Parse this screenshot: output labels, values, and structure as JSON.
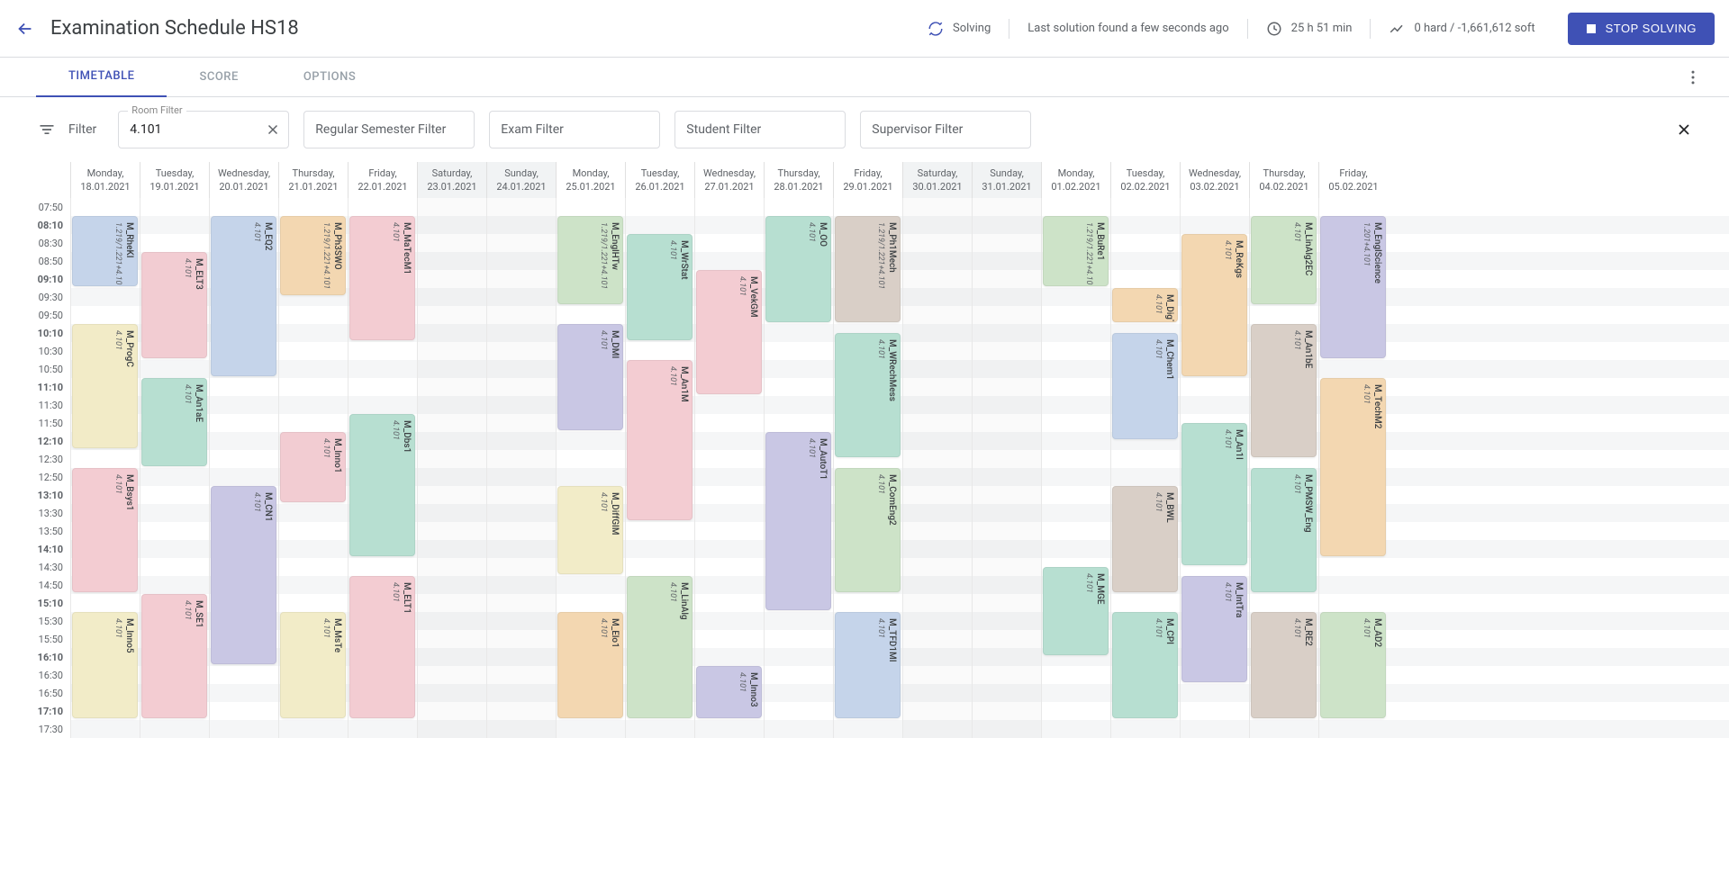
{
  "header": {
    "title": "Examination Schedule HS18",
    "solving_status": "Solving",
    "last_solution": "Last solution found a few seconds ago",
    "duration": "25 h 51 min",
    "score": "0 hard / -1,661,612 soft",
    "stop_label": "STOP SOLVING"
  },
  "tabs": {
    "timetable": "TIMETABLE",
    "score": "SCORE",
    "options": "OPTIONS"
  },
  "filterbar": {
    "label": "Filter",
    "room_filter_label": "Room Filter",
    "room_filter_value": "4.101",
    "regular": "Regular Semester Filter",
    "exam": "Exam Filter",
    "student": "Student Filter",
    "supervisor": "Supervisor Filter"
  },
  "time_axis": {
    "start_minutes": 470,
    "end_minutes": 1050,
    "labels": [
      {
        "m": 470,
        "text": "07:50",
        "bold": false
      },
      {
        "m": 490,
        "text": "08:10",
        "bold": true
      },
      {
        "m": 510,
        "text": "08:30",
        "bold": false
      },
      {
        "m": 530,
        "text": "08:50",
        "bold": false
      },
      {
        "m": 550,
        "text": "09:10",
        "bold": true
      },
      {
        "m": 570,
        "text": "09:30",
        "bold": false
      },
      {
        "m": 590,
        "text": "09:50",
        "bold": false
      },
      {
        "m": 610,
        "text": "10:10",
        "bold": true
      },
      {
        "m": 630,
        "text": "10:30",
        "bold": false
      },
      {
        "m": 650,
        "text": "10:50",
        "bold": false
      },
      {
        "m": 670,
        "text": "11:10",
        "bold": true
      },
      {
        "m": 690,
        "text": "11:30",
        "bold": false
      },
      {
        "m": 710,
        "text": "11:50",
        "bold": false
      },
      {
        "m": 730,
        "text": "12:10",
        "bold": true
      },
      {
        "m": 750,
        "text": "12:30",
        "bold": false
      },
      {
        "m": 770,
        "text": "12:50",
        "bold": false
      },
      {
        "m": 790,
        "text": "13:10",
        "bold": true
      },
      {
        "m": 810,
        "text": "13:30",
        "bold": false
      },
      {
        "m": 830,
        "text": "13:50",
        "bold": false
      },
      {
        "m": 850,
        "text": "14:10",
        "bold": true
      },
      {
        "m": 870,
        "text": "14:30",
        "bold": false
      },
      {
        "m": 890,
        "text": "14:50",
        "bold": false
      },
      {
        "m": 910,
        "text": "15:10",
        "bold": true
      },
      {
        "m": 930,
        "text": "15:30",
        "bold": false
      },
      {
        "m": 950,
        "text": "15:50",
        "bold": false
      },
      {
        "m": 970,
        "text": "16:10",
        "bold": true
      },
      {
        "m": 990,
        "text": "16:30",
        "bold": false
      },
      {
        "m": 1010,
        "text": "16:50",
        "bold": false
      },
      {
        "m": 1030,
        "text": "17:10",
        "bold": true
      },
      {
        "m": 1050,
        "text": "17:30",
        "bold": false
      }
    ]
  },
  "days": [
    {
      "weekday": "Monday,",
      "date": "18.01.2021",
      "weekend": false
    },
    {
      "weekday": "Tuesday,",
      "date": "19.01.2021",
      "weekend": false
    },
    {
      "weekday": "Wednesday,",
      "date": "20.01.2021",
      "weekend": false
    },
    {
      "weekday": "Thursday,",
      "date": "21.01.2021",
      "weekend": false
    },
    {
      "weekday": "Friday,",
      "date": "22.01.2021",
      "weekend": false
    },
    {
      "weekday": "Saturday,",
      "date": "23.01.2021",
      "weekend": true
    },
    {
      "weekday": "Sunday,",
      "date": "24.01.2021",
      "weekend": true
    },
    {
      "weekday": "Monday,",
      "date": "25.01.2021",
      "weekend": false
    },
    {
      "weekday": "Tuesday,",
      "date": "26.01.2021",
      "weekend": false
    },
    {
      "weekday": "Wednesday,",
      "date": "27.01.2021",
      "weekend": false
    },
    {
      "weekday": "Thursday,",
      "date": "28.01.2021",
      "weekend": false
    },
    {
      "weekday": "Friday,",
      "date": "29.01.2021",
      "weekend": false
    },
    {
      "weekday": "Saturday,",
      "date": "30.01.2021",
      "weekend": true
    },
    {
      "weekday": "Sunday,",
      "date": "31.01.2021",
      "weekend": true
    },
    {
      "weekday": "Monday,",
      "date": "01.02.2021",
      "weekend": false
    },
    {
      "weekday": "Tuesday,",
      "date": "02.02.2021",
      "weekend": false
    },
    {
      "weekday": "Wednesday,",
      "date": "03.02.2021",
      "weekend": false
    },
    {
      "weekday": "Thursday,",
      "date": "04.02.2021",
      "weekend": false
    },
    {
      "weekday": "Friday,",
      "date": "05.02.2021",
      "weekend": false
    }
  ],
  "events": [
    {
      "day": 0,
      "start": 490,
      "end": 570,
      "title": "M_RheKI",
      "room": "1.219/1.221+4.101",
      "color": "#c5d4ea"
    },
    {
      "day": 0,
      "start": 610,
      "end": 750,
      "title": "M_ProgC",
      "room": "4.101",
      "color": "#f2ebc7"
    },
    {
      "day": 0,
      "start": 770,
      "end": 910,
      "title": "M_Bsys1",
      "room": "4.101",
      "color": "#f3ccd2"
    },
    {
      "day": 0,
      "start": 930,
      "end": 1050,
      "title": "M_Inno5",
      "room": "4.101",
      "color": "#f2ecc8"
    },
    {
      "day": 1,
      "start": 530,
      "end": 650,
      "title": "M_ELT3",
      "room": "4.101",
      "color": "#f2ccd2"
    },
    {
      "day": 1,
      "start": 670,
      "end": 770,
      "title": "M_An1aE",
      "room": "4.101",
      "color": "#b7dfd1"
    },
    {
      "day": 1,
      "start": 910,
      "end": 1050,
      "title": "M_SE1",
      "room": "4.101",
      "color": "#f3ccd2"
    },
    {
      "day": 2,
      "start": 490,
      "end": 670,
      "title": "M_EQ2",
      "room": "4.101",
      "color": "#c5d4ea"
    },
    {
      "day": 2,
      "start": 790,
      "end": 990,
      "title": "M_CN1",
      "room": "4.101",
      "color": "#c9c7e4"
    },
    {
      "day": 3,
      "start": 490,
      "end": 580,
      "title": "M_Ph3SWO",
      "room": "1.219/1.221+4.101",
      "color": "#f3d7b1"
    },
    {
      "day": 3,
      "start": 730,
      "end": 810,
      "title": "M_Inno1",
      "room": "4.101",
      "color": "#f2ccd2"
    },
    {
      "day": 3,
      "start": 930,
      "end": 1050,
      "title": "M_MsTe",
      "room": "4.101",
      "color": "#f2ecc8"
    },
    {
      "day": 4,
      "start": 490,
      "end": 630,
      "title": "M_MaTecM1",
      "room": "4.101",
      "color": "#f3ccd2"
    },
    {
      "day": 4,
      "start": 710,
      "end": 870,
      "title": "M_Dbs1",
      "room": "4.101",
      "color": "#b7dfd1"
    },
    {
      "day": 4,
      "start": 890,
      "end": 1050,
      "title": "M_ELT1",
      "room": "4.101",
      "color": "#f3ccd2"
    },
    {
      "day": 7,
      "start": 490,
      "end": 590,
      "title": "M_EnglHTw",
      "room": "1.219/1.221+4.101",
      "color": "#cde3c8"
    },
    {
      "day": 7,
      "start": 610,
      "end": 730,
      "title": "M_DMI",
      "room": "4.101",
      "color": "#c9c7e4"
    },
    {
      "day": 7,
      "start": 790,
      "end": 890,
      "title": "M_DiffGlM",
      "room": "4.101",
      "color": "#f2ecc8"
    },
    {
      "day": 7,
      "start": 930,
      "end": 1050,
      "title": "M_Elo1",
      "room": "4.101",
      "color": "#f3d7b1"
    },
    {
      "day": 8,
      "start": 510,
      "end": 630,
      "title": "M_WrStat",
      "room": "4.101",
      "color": "#b7dfd1"
    },
    {
      "day": 8,
      "start": 650,
      "end": 830,
      "title": "M_An1M",
      "room": "4.101",
      "color": "#f3ccd2"
    },
    {
      "day": 8,
      "start": 890,
      "end": 1050,
      "title": "M_LinAlg",
      "room": "4.101",
      "color": "#cde3c8"
    },
    {
      "day": 9,
      "start": 550,
      "end": 690,
      "title": "M_VekGM",
      "room": "4.101",
      "color": "#f3ccd2"
    },
    {
      "day": 9,
      "start": 990,
      "end": 1050,
      "title": "M_Inno3",
      "room": "4.101",
      "color": "#c9c7e4"
    },
    {
      "day": 10,
      "start": 490,
      "end": 610,
      "title": "M_OO",
      "room": "4.101",
      "color": "#b7dfd1"
    },
    {
      "day": 10,
      "start": 730,
      "end": 930,
      "title": "M_AutoT1",
      "room": "4.101",
      "color": "#c9c7e4"
    },
    {
      "day": 11,
      "start": 490,
      "end": 610,
      "title": "M_Ph1Mech",
      "room": "1.219/1.221+4.101",
      "color": "#d9cfc7"
    },
    {
      "day": 11,
      "start": 620,
      "end": 760,
      "title": "M_WRechMess",
      "room": "4.101",
      "color": "#b7dfd1"
    },
    {
      "day": 11,
      "start": 770,
      "end": 910,
      "title": "M_ComEng2",
      "room": "4.101",
      "color": "#cde3c8"
    },
    {
      "day": 11,
      "start": 930,
      "end": 1050,
      "title": "M_TFD1MI",
      "room": "4.101",
      "color": "#c5d4ea"
    },
    {
      "day": 14,
      "start": 490,
      "end": 570,
      "title": "M_BuRe1",
      "room": "1.219/1.221+4.101",
      "color": "#cde3c8"
    },
    {
      "day": 14,
      "start": 880,
      "end": 980,
      "title": "M_MGE",
      "room": "4.101",
      "color": "#b7dfd1"
    },
    {
      "day": 15,
      "start": 570,
      "end": 610,
      "title": "M_DigT",
      "room": "4.101",
      "color": "#f3d7b1"
    },
    {
      "day": 15,
      "start": 620,
      "end": 740,
      "title": "M_Chem1",
      "room": "4.101",
      "color": "#c5d4ea"
    },
    {
      "day": 15,
      "start": 790,
      "end": 910,
      "title": "M_BWL",
      "room": "4.101",
      "color": "#d9cfc7"
    },
    {
      "day": 15,
      "start": 930,
      "end": 1050,
      "title": "M_CPI",
      "room": "4.101",
      "color": "#b7dfd1"
    },
    {
      "day": 16,
      "start": 510,
      "end": 670,
      "title": "M_ReKgs",
      "room": "4.101",
      "color": "#f3d7b1"
    },
    {
      "day": 16,
      "start": 720,
      "end": 880,
      "title": "M_An1I",
      "room": "4.101",
      "color": "#b7dfd1"
    },
    {
      "day": 16,
      "start": 890,
      "end": 1010,
      "title": "M_IntTra",
      "room": "4.101",
      "color": "#c9c7e4"
    },
    {
      "day": 17,
      "start": 490,
      "end": 590,
      "title": "M_LinAlg2EC",
      "room": "4.101",
      "color": "#cde3c8"
    },
    {
      "day": 17,
      "start": 610,
      "end": 760,
      "title": "M_An1bE",
      "room": "4.101",
      "color": "#d9cfc7"
    },
    {
      "day": 17,
      "start": 770,
      "end": 910,
      "title": "M_PMSW_Eng",
      "room": "4.101",
      "color": "#b7dfd1"
    },
    {
      "day": 17,
      "start": 930,
      "end": 1050,
      "title": "M_RE2",
      "room": "4.101",
      "color": "#d9cfc7"
    },
    {
      "day": 18,
      "start": 490,
      "end": 650,
      "title": "M_EnglScience",
      "room": "1.201+4.101",
      "color": "#c9c7e4"
    },
    {
      "day": 18,
      "start": 670,
      "end": 870,
      "title": "M_TechM2",
      "room": "4.101",
      "color": "#f3d7b1"
    },
    {
      "day": 18,
      "start": 930,
      "end": 1050,
      "title": "M_AD2",
      "room": "4.101",
      "color": "#cde3c8"
    }
  ]
}
